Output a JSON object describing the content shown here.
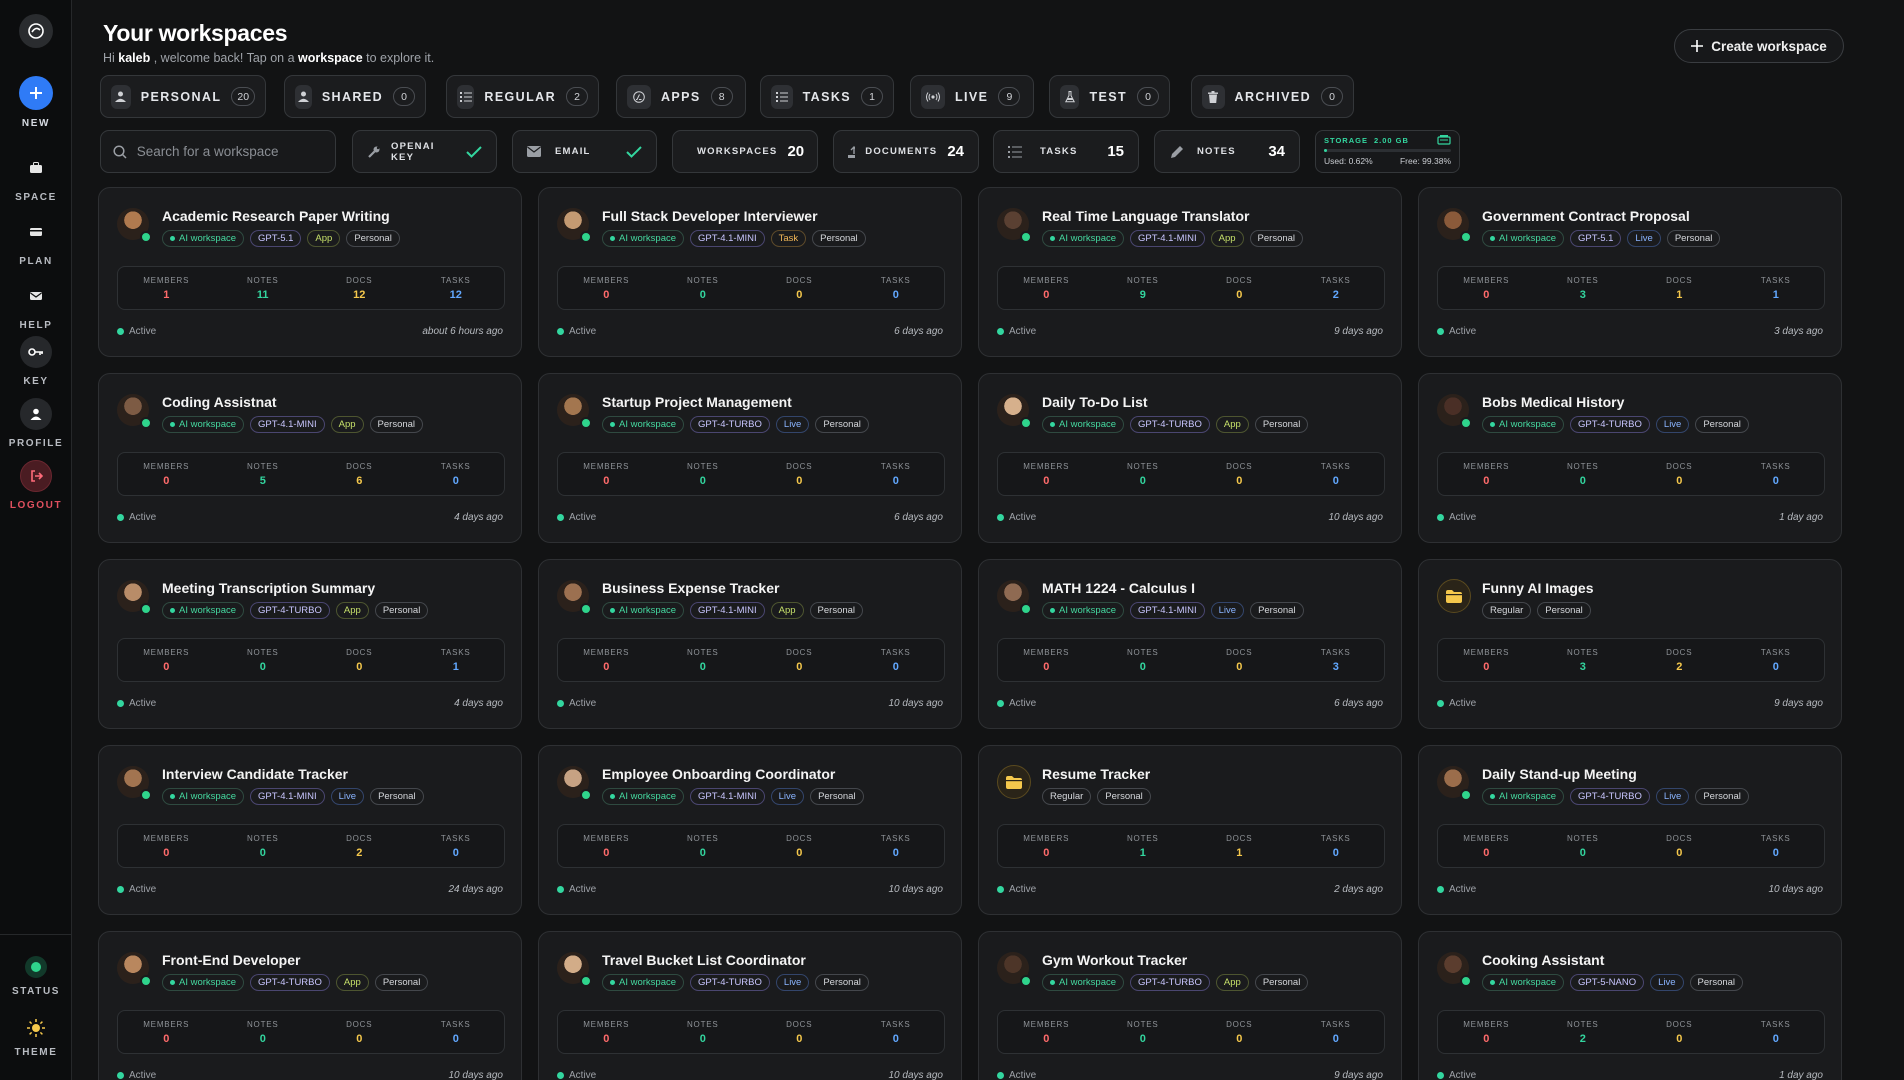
{
  "sidebar": {
    "items": [
      {
        "label": "NEW",
        "icon": "plus-icon"
      },
      {
        "label": "SPACE",
        "icon": "briefcase-icon"
      },
      {
        "label": "PLAN",
        "icon": "plan-icon"
      },
      {
        "label": "HELP",
        "icon": "mail-icon"
      },
      {
        "label": "KEY",
        "icon": "key-icon"
      },
      {
        "label": "PROFILE",
        "icon": "user-icon"
      },
      {
        "label": "LOGOUT",
        "icon": "logout-icon"
      },
      {
        "label": "STATUS",
        "icon": "status-icon"
      },
      {
        "label": "THEME",
        "icon": "sun-icon"
      }
    ]
  },
  "header": {
    "title": "Your workspaces",
    "subtitle_pre": "Hi ",
    "user": "kaleb",
    "subtitle_mid": " , welcome back! Tap on a ",
    "workspace_word": "workspace",
    "subtitle_post": " to explore it.",
    "create_label": "Create workspace"
  },
  "tabs": [
    {
      "label": "PERSONAL",
      "count": "20"
    },
    {
      "label": "SHARED",
      "count": "0"
    },
    {
      "label": "REGULAR",
      "count": "2"
    },
    {
      "label": "APPS",
      "count": "8"
    },
    {
      "label": "TASKS",
      "count": "1"
    },
    {
      "label": "LIVE",
      "count": "9"
    },
    {
      "label": "TEST",
      "count": "0"
    },
    {
      "label": "ARCHIVED",
      "count": "0"
    }
  ],
  "search": {
    "placeholder": "Search for a workspace"
  },
  "stats": [
    {
      "label": "OPENAI KEY",
      "value": ""
    },
    {
      "label": "EMAIL",
      "value": ""
    },
    {
      "label": "WORKSPACES",
      "value": "20"
    },
    {
      "label": "DOCUMENTS",
      "value": "24"
    },
    {
      "label": "TASKS",
      "value": "15"
    },
    {
      "label": "NOTES",
      "value": "34"
    }
  ],
  "storage": {
    "label": "STORAGE",
    "total": "2.00 GB",
    "used": "Used: 0.62%",
    "free": "Free: 99.38%",
    "used_fraction": 0.0062
  },
  "stat_labels": {
    "members": "MEMBERS",
    "notes": "NOTES",
    "docs": "DOCS",
    "tasks": "TASKS"
  },
  "status_label": "Active",
  "cards": [
    {
      "title": "Academic Research Paper Writing",
      "avatar": "#b07a4f",
      "badges": [
        [
          "AI workspace",
          "ai"
        ],
        [
          "GPT-5.1",
          "model"
        ],
        [
          "App",
          "app"
        ],
        [
          "Personal",
          ""
        ]
      ],
      "members": "1",
      "notes": "11",
      "docs": "12",
      "tasks": "12",
      "time": "about 6 hours ago"
    },
    {
      "title": "Full Stack Developer Interviewer",
      "avatar": "#c49a72",
      "badges": [
        [
          "AI workspace",
          "ai"
        ],
        [
          "GPT-4.1-MINI",
          "model"
        ],
        [
          "Task",
          "task"
        ],
        [
          "Personal",
          ""
        ]
      ],
      "members": "0",
      "notes": "0",
      "docs": "0",
      "tasks": "0",
      "time": "6 days ago"
    },
    {
      "title": "Real Time Language Translator",
      "avatar": "#5a4032",
      "badges": [
        [
          "AI workspace",
          "ai"
        ],
        [
          "GPT-4.1-MINI",
          "model"
        ],
        [
          "App",
          "app"
        ],
        [
          "Personal",
          ""
        ]
      ],
      "members": "0",
      "notes": "9",
      "docs": "0",
      "tasks": "2",
      "time": "9 days ago"
    },
    {
      "title": "Government Contract Proposal",
      "avatar": "#8a5a3a",
      "badges": [
        [
          "AI workspace",
          "ai"
        ],
        [
          "GPT-5.1",
          "model"
        ],
        [
          "Live",
          "live"
        ],
        [
          "Personal",
          ""
        ]
      ],
      "members": "0",
      "notes": "3",
      "docs": "1",
      "tasks": "1",
      "time": "3 days ago"
    },
    {
      "title": "Coding Assistnat",
      "avatar": "#7d5b44",
      "badges": [
        [
          "AI workspace",
          "ai"
        ],
        [
          "GPT-4.1-MINI",
          "model"
        ],
        [
          "App",
          "app"
        ],
        [
          "Personal",
          ""
        ]
      ],
      "members": "0",
      "notes": "5",
      "docs": "6",
      "tasks": "0",
      "time": "4 days ago"
    },
    {
      "title": "Startup Project Management",
      "avatar": "#a3764f",
      "badges": [
        [
          "AI workspace",
          "ai"
        ],
        [
          "GPT-4-TURBO",
          "model"
        ],
        [
          "Live",
          "live"
        ],
        [
          "Personal",
          ""
        ]
      ],
      "members": "0",
      "notes": "0",
      "docs": "0",
      "tasks": "0",
      "time": "6 days ago"
    },
    {
      "title": "Daily To-Do List",
      "avatar": "#d6b08c",
      "badges": [
        [
          "AI workspace",
          "ai"
        ],
        [
          "GPT-4-TURBO",
          "model"
        ],
        [
          "App",
          "app"
        ],
        [
          "Personal",
          ""
        ]
      ],
      "members": "0",
      "notes": "0",
      "docs": "0",
      "tasks": "0",
      "time": "10 days ago"
    },
    {
      "title": "Bobs Medical History",
      "avatar": "#4a2f26",
      "badges": [
        [
          "AI workspace",
          "ai"
        ],
        [
          "GPT-4-TURBO",
          "model"
        ],
        [
          "Live",
          "live"
        ],
        [
          "Personal",
          ""
        ]
      ],
      "members": "0",
      "notes": "0",
      "docs": "0",
      "tasks": "0",
      "time": "1 day ago"
    },
    {
      "title": "Meeting Transcription Summary",
      "avatar": "#b88c68",
      "badges": [
        [
          "AI workspace",
          "ai"
        ],
        [
          "GPT-4-TURBO",
          "model"
        ],
        [
          "App",
          "app"
        ],
        [
          "Personal",
          ""
        ]
      ],
      "members": "0",
      "notes": "0",
      "docs": "0",
      "tasks": "1",
      "time": "4 days ago"
    },
    {
      "title": "Business Expense Tracker",
      "avatar": "#9c7050",
      "badges": [
        [
          "AI workspace",
          "ai"
        ],
        [
          "GPT-4.1-MINI",
          "model"
        ],
        [
          "App",
          "app"
        ],
        [
          "Personal",
          ""
        ]
      ],
      "members": "0",
      "notes": "0",
      "docs": "0",
      "tasks": "0",
      "time": "10 days ago"
    },
    {
      "title": "MATH 1224 - Calculus I",
      "avatar": "#8f6a52",
      "badges": [
        [
          "AI workspace",
          "ai"
        ],
        [
          "GPT-4.1-MINI",
          "model"
        ],
        [
          "Live",
          "live"
        ],
        [
          "Personal",
          ""
        ]
      ],
      "members": "0",
      "notes": "0",
      "docs": "0",
      "tasks": "3",
      "time": "6 days ago"
    },
    {
      "title": "Funny AI Images",
      "folder": true,
      "badges": [
        [
          "Regular",
          ""
        ],
        [
          "Personal",
          ""
        ]
      ],
      "members": "0",
      "notes": "3",
      "docs": "2",
      "tasks": "0",
      "time": "9 days ago"
    },
    {
      "title": "Interview Candidate Tracker",
      "avatar": "#a27450",
      "badges": [
        [
          "AI workspace",
          "ai"
        ],
        [
          "GPT-4.1-MINI",
          "model"
        ],
        [
          "Live",
          "live"
        ],
        [
          "Personal",
          ""
        ]
      ],
      "members": "0",
      "notes": "0",
      "docs": "2",
      "tasks": "0",
      "time": "24 days ago"
    },
    {
      "title": "Employee Onboarding Coordinator",
      "avatar": "#c7a283",
      "badges": [
        [
          "AI workspace",
          "ai"
        ],
        [
          "GPT-4.1-MINI",
          "model"
        ],
        [
          "Live",
          "live"
        ],
        [
          "Personal",
          ""
        ]
      ],
      "members": "0",
      "notes": "0",
      "docs": "0",
      "tasks": "0",
      "time": "10 days ago"
    },
    {
      "title": "Resume Tracker",
      "folder": true,
      "badges": [
        [
          "Regular",
          ""
        ],
        [
          "Personal",
          ""
        ]
      ],
      "members": "0",
      "notes": "1",
      "docs": "1",
      "tasks": "0",
      "time": "2 days ago"
    },
    {
      "title": "Daily Stand-up Meeting",
      "avatar": "#9b6d4b",
      "badges": [
        [
          "AI workspace",
          "ai"
        ],
        [
          "GPT-4-TURBO",
          "model"
        ],
        [
          "Live",
          "live"
        ],
        [
          "Personal",
          ""
        ]
      ],
      "members": "0",
      "notes": "0",
      "docs": "0",
      "tasks": "0",
      "time": "10 days ago"
    },
    {
      "title": "Front-End Developer",
      "avatar": "#b9875e",
      "badges": [
        [
          "AI workspace",
          "ai"
        ],
        [
          "GPT-4-TURBO",
          "model"
        ],
        [
          "App",
          "app"
        ],
        [
          "Personal",
          ""
        ]
      ],
      "members": "0",
      "notes": "0",
      "docs": "0",
      "tasks": "0",
      "time": "10 days ago"
    },
    {
      "title": "Travel Bucket List Coordinator",
      "avatar": "#d2ac88",
      "badges": [
        [
          "AI workspace",
          "ai"
        ],
        [
          "GPT-4-TURBO",
          "model"
        ],
        [
          "Live",
          "live"
        ],
        [
          "Personal",
          ""
        ]
      ],
      "members": "0",
      "notes": "0",
      "docs": "0",
      "tasks": "0",
      "time": "10 days ago"
    },
    {
      "title": "Gym Workout Tracker",
      "avatar": "#4d3528",
      "badges": [
        [
          "AI workspace",
          "ai"
        ],
        [
          "GPT-4-TURBO",
          "model"
        ],
        [
          "App",
          "app"
        ],
        [
          "Personal",
          ""
        ]
      ],
      "members": "0",
      "notes": "0",
      "docs": "0",
      "tasks": "0",
      "time": "9 days ago"
    },
    {
      "title": "Cooking Assistant",
      "avatar": "#5b3d2e",
      "badges": [
        [
          "AI workspace",
          "ai"
        ],
        [
          "GPT-5-NANO",
          "model"
        ],
        [
          "Live",
          "live"
        ],
        [
          "Personal",
          ""
        ]
      ],
      "members": "0",
      "notes": "2",
      "docs": "0",
      "tasks": "0",
      "time": "1 day ago"
    }
  ]
}
